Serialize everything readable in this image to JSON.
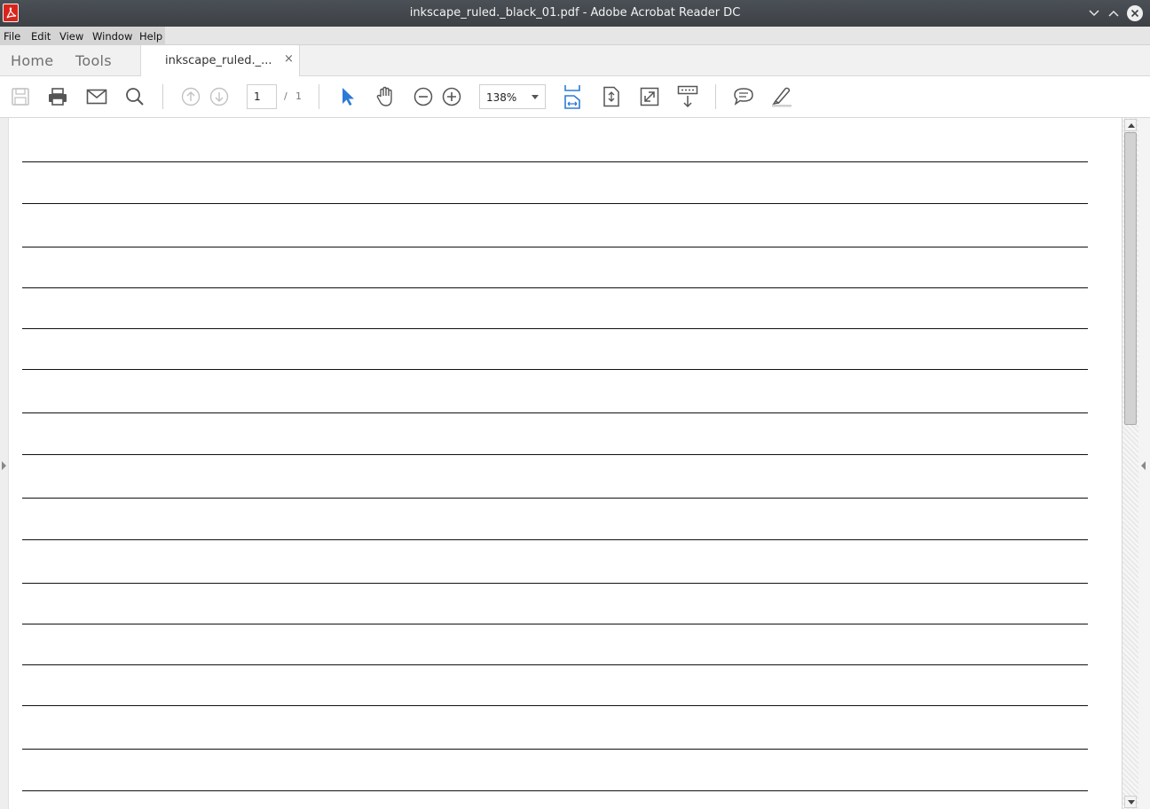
{
  "window": {
    "title": "inkscape_ruled._black_01.pdf - Adobe Acrobat Reader DC",
    "app_icon": "acrobat-pdf-icon",
    "controls": [
      "minimize-icon",
      "maximize-icon",
      "close-icon"
    ]
  },
  "menu": {
    "file": "File",
    "edit": "Edit",
    "view": "View",
    "window": "Window",
    "help": "Help"
  },
  "tabs": {
    "home": "Home",
    "tools": "Tools",
    "document": "inkscape_ruled._...",
    "close_glyph": "×"
  },
  "toolbar": {
    "page_current": "1",
    "page_separator": "/",
    "page_total": "1",
    "zoom": "138%",
    "icons": [
      "save-icon",
      "print-icon",
      "email-icon",
      "search-icon",
      "prev-page-icon",
      "next-page-icon",
      "select-cursor-icon",
      "hand-tool-icon",
      "zoom-out-icon",
      "zoom-in-icon",
      "fit-width-icon",
      "fit-page-icon",
      "full-screen-icon",
      "read-mode-icon",
      "comment-icon",
      "highlight-icon"
    ]
  },
  "document": {
    "content": "ruled lines",
    "line_color": "#111111",
    "ruled_line_count": 16
  },
  "colors": {
    "accent": "#2d7bd6",
    "titlebar": "#43474c"
  }
}
